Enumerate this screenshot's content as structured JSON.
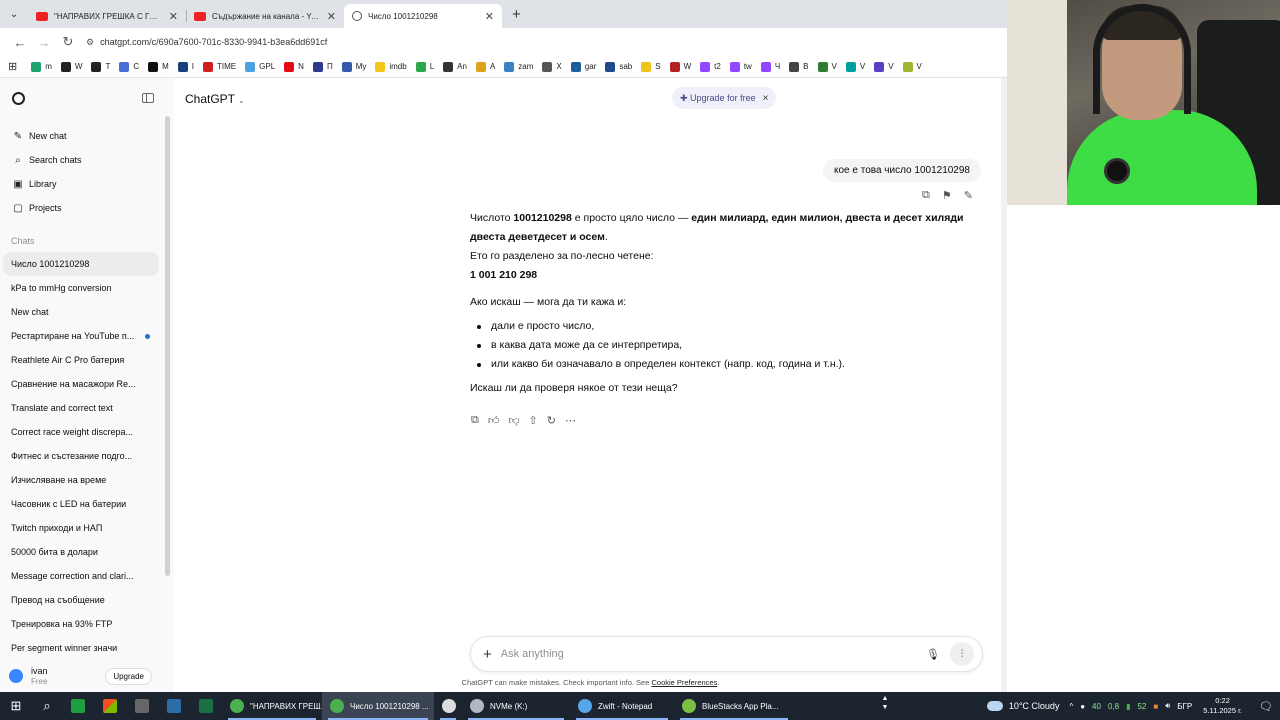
{
  "browser": {
    "tabs": [
      {
        "title": "\"НАПРАВИХ ГРЕШКА С ГЪМО...",
        "favicon": "youtube-icon",
        "active": false
      },
      {
        "title": "Съдържание на канала - YouT...",
        "favicon": "youtube-icon",
        "active": false
      },
      {
        "title": "Число 1001210298",
        "favicon": "chatgpt-icon",
        "active": true
      }
    ],
    "new_tab_glyph": "+",
    "close_glyph": "✕",
    "url": "chatgpt.com/c/690a7600-701c-8330-9941-b3ea6dd691cf",
    "bookmarks": [
      {
        "label": "m",
        "color": "#1aa36f"
      },
      {
        "label": "W",
        "color": "#222222"
      },
      {
        "label": "T",
        "color": "#222222"
      },
      {
        "label": "C",
        "color": "#4a6cd4"
      },
      {
        "label": "M",
        "color": "#111111"
      },
      {
        "label": "I",
        "color": "#17407f"
      },
      {
        "label": "TIME",
        "color": "#d11f1f"
      },
      {
        "label": "GPL",
        "color": "#4aa3df"
      },
      {
        "label": "N",
        "color": "#e50914"
      },
      {
        "label": "П",
        "color": "#2b3a8c"
      },
      {
        "label": "My",
        "color": "#3658a8"
      },
      {
        "label": "imdb",
        "color": "#f5c518"
      },
      {
        "label": "L",
        "color": "#2aa84a"
      },
      {
        "label": "An",
        "color": "#333333"
      },
      {
        "label": "A",
        "color": "#e0a21b"
      },
      {
        "label": "zam",
        "color": "#3b82c4"
      },
      {
        "label": "X",
        "color": "#555555"
      },
      {
        "label": "gar",
        "color": "#1b5e9e"
      },
      {
        "label": "sab",
        "color": "#1c4a8a"
      },
      {
        "label": "S",
        "color": "#f0c419"
      },
      {
        "label": "W",
        "color": "#b22222"
      },
      {
        "label": "t2",
        "color": "#9146ff"
      },
      {
        "label": "tw",
        "color": "#9146ff"
      },
      {
        "label": "Ч",
        "color": "#9146ff"
      },
      {
        "label": "В",
        "color": "#444444"
      },
      {
        "label": "V",
        "color": "#2e7d32"
      },
      {
        "label": "V",
        "color": "#00a0a0"
      },
      {
        "label": "V",
        "color": "#5b3fc4"
      },
      {
        "label": "V",
        "color": "#9cb62d"
      }
    ]
  },
  "sidebar": {
    "nav": [
      {
        "label": "New chat",
        "icon": "new-chat-icon",
        "glyph": "✎"
      },
      {
        "label": "Search chats",
        "icon": "search-icon",
        "glyph": "⌕"
      },
      {
        "label": "Library",
        "icon": "library-icon",
        "glyph": "▣"
      },
      {
        "label": "Projects",
        "icon": "projects-icon",
        "glyph": "▢"
      }
    ],
    "section_label": "Chats",
    "chats": [
      {
        "title": "Число 1001210298",
        "active": true,
        "dot": false
      },
      {
        "title": "kPa to mmHg conversion",
        "active": false,
        "dot": false
      },
      {
        "title": "New chat",
        "active": false,
        "dot": false
      },
      {
        "title": "Рестартиране на YouTube п...",
        "active": false,
        "dot": true
      },
      {
        "title": "Reathlete Air C Pro батерия",
        "active": false,
        "dot": false
      },
      {
        "title": "Сравнение на масажори Re...",
        "active": false,
        "dot": false
      },
      {
        "title": "Translate and correct text",
        "active": false,
        "dot": false
      },
      {
        "title": "Correct race weight discrepa...",
        "active": false,
        "dot": false
      },
      {
        "title": "Фитнес и състезание подго...",
        "active": false,
        "dot": false
      },
      {
        "title": "Изчисляване на време",
        "active": false,
        "dot": false
      },
      {
        "title": "Часовник с LED на батерии",
        "active": false,
        "dot": false
      },
      {
        "title": "Twitch приходи и НАП",
        "active": false,
        "dot": false
      },
      {
        "title": "50000 бита в долари",
        "active": false,
        "dot": false
      },
      {
        "title": "Message correction and clari...",
        "active": false,
        "dot": false
      },
      {
        "title": "Превод на съобщение",
        "active": false,
        "dot": false
      },
      {
        "title": "Тренировка на 93% FTP",
        "active": false,
        "dot": false
      },
      {
        "title": "Per segment winner значи",
        "active": false,
        "dot": false
      }
    ],
    "user": {
      "name": "ivan",
      "plan": "Free",
      "upgrade_label": "Upgrade"
    }
  },
  "main": {
    "model_label": "ChatGPT",
    "upgrade_pill": "✚ Upgrade for free",
    "user_message": "кое е това число 1001210298",
    "answer": {
      "p1_a": "Числото ",
      "p1_b": "1001210298",
      "p1_c": " е просто цяло число — ",
      "p1_d": "един милиард, един милион, двеста и десет хиляди двеста деветдесет и осем",
      "p1_e": ".",
      "p2": "Ето го разделено за по-лесно четене:",
      "p3": "1 001 210 298",
      "p4": "Ако искаш — мога да ти кажа и:",
      "bullets": [
        "дали е просто число,",
        "в каква дата може да се интерпретира,",
        "или какво би означавало в определен контекст (напр. код, година и т.н.)."
      ],
      "p5": "Искаш ли да проверя някое от тези неща?"
    },
    "composer_placeholder": "Ask anything",
    "disclaimer": "ChatGPT can make mistakes. Check important info. See ",
    "disclaimer_link": "Cookie Preferences",
    "disclaimer_end": "."
  },
  "taskbar": {
    "apps": [
      {
        "label": "\"НАПРАВИХ ГРЕШ...",
        "color": "#4caf50",
        "active": false
      },
      {
        "label": "Число 1001210298 ...",
        "color": "#4caf50",
        "active": true
      },
      {
        "label": "",
        "color": "#dddddd",
        "active": false
      },
      {
        "label": "NVMe (K:)",
        "color": "#b0b8c4",
        "active": false
      },
      {
        "label": "Zwift - Notepad",
        "color": "#57a6e8",
        "active": false
      },
      {
        "label": "BlueStacks App Pla...",
        "color": "#7ac143",
        "active": false
      }
    ],
    "weather": "10°C  Cloudy",
    "tray_a": "40",
    "tray_b": "0,8",
    "tray_c": "52",
    "lang": "БГР",
    "time": "0:22",
    "date": "5.11.2025 г."
  }
}
